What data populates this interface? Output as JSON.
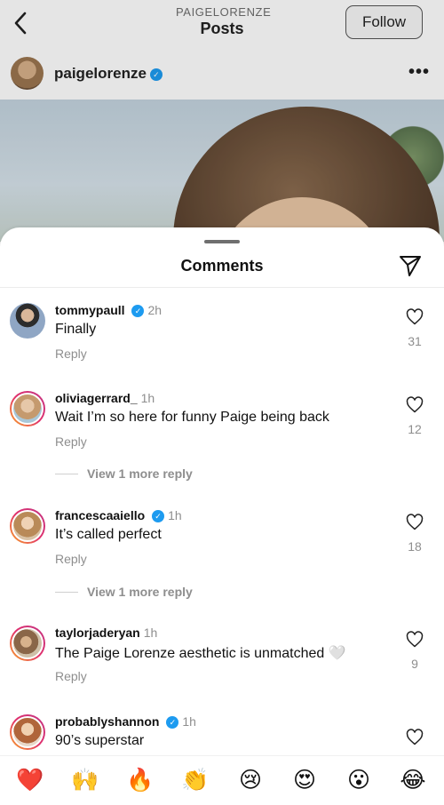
{
  "header": {
    "username": "PAIGELORENZE",
    "title": "Posts",
    "follow_label": "Follow"
  },
  "post": {
    "owner": "paigelorenze"
  },
  "sheet": {
    "title": "Comments"
  },
  "comments": [
    {
      "user": "tommypaull",
      "verified": true,
      "time": "2h",
      "text": "Finally",
      "reply_label": "Reply",
      "likes": "31"
    },
    {
      "user": "oliviagerrard_",
      "verified": false,
      "time": "1h",
      "text": "Wait I’m so here for funny Paige being back",
      "reply_label": "Reply",
      "likes": "12",
      "view_more": "View 1 more reply"
    },
    {
      "user": "francescaaiello",
      "verified": true,
      "time": "1h",
      "text": "It’s called perfect",
      "reply_label": "Reply",
      "likes": "18",
      "view_more": "View 1 more reply"
    },
    {
      "user": "taylorjaderyan",
      "verified": false,
      "time": "1h",
      "text": "The Paige Lorenze aesthetic is unmatched 🤍",
      "reply_label": "Reply",
      "likes": "9"
    },
    {
      "user": "probablyshannon",
      "verified": true,
      "time": "1h",
      "text": "90’s superstar"
    }
  ],
  "emoji_bar": [
    "❤️",
    "🙌",
    "🔥",
    "👏",
    "😢",
    "😍",
    "😮",
    "😂"
  ],
  "colors": {
    "verified": "#1d9bf0",
    "muted": "#8e8e8e",
    "story_ring_start": "#f9a825",
    "story_ring_end": "#c13584"
  },
  "icons": [
    "back-arrow-icon",
    "verified-badge-icon",
    "more-options-icon",
    "share-send-icon",
    "heart-icon"
  ]
}
